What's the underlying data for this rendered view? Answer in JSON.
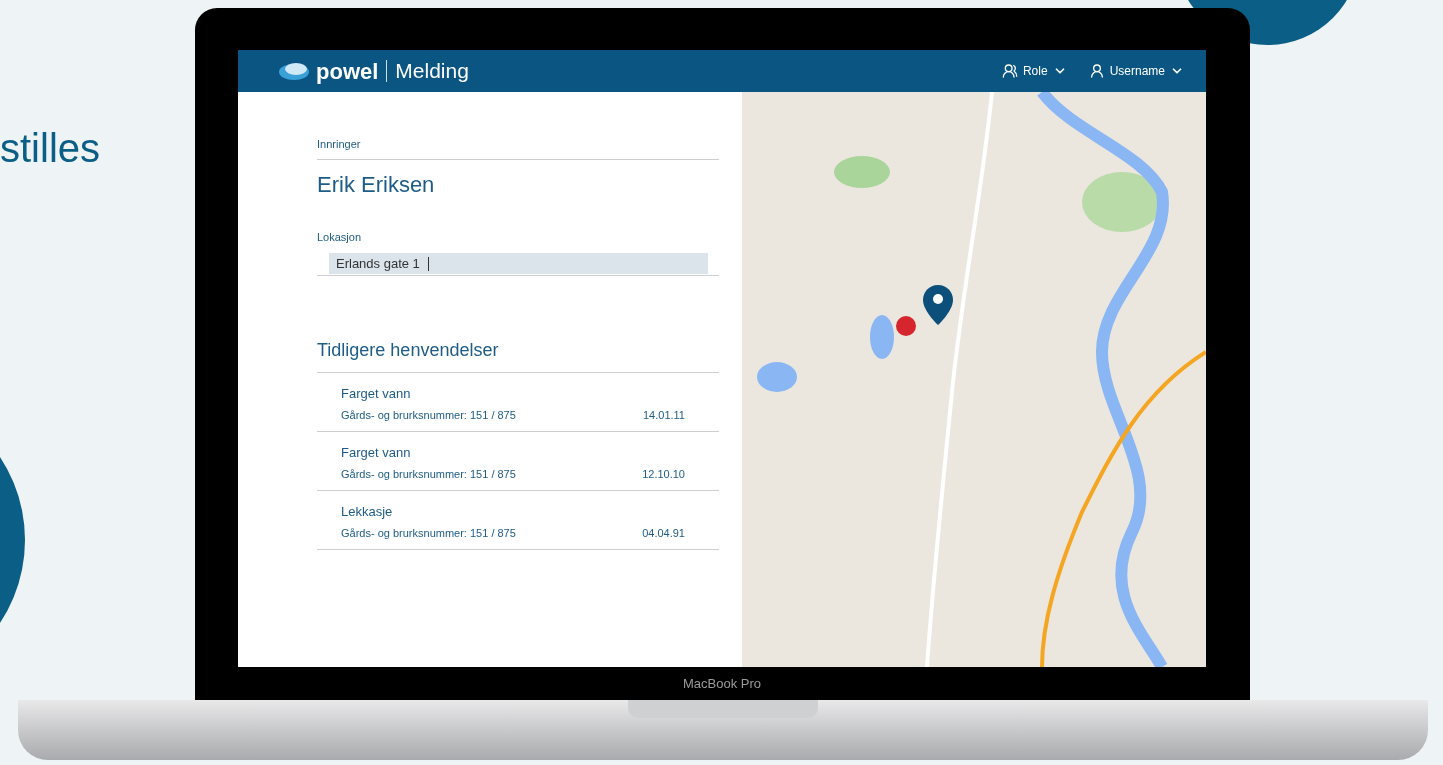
{
  "background_text": "stilles",
  "header": {
    "logo": "powel",
    "app_name": "Melding",
    "menus": [
      {
        "label": "Role",
        "kind": "role"
      },
      {
        "label": "Username",
        "kind": "user"
      }
    ]
  },
  "caller": {
    "label": "Innringer",
    "name": "Erik Eriksen"
  },
  "location": {
    "label": "Lokasjon",
    "value": "Erlands gate 1"
  },
  "history": {
    "title": "Tidligere henvendelser",
    "items": [
      {
        "title": "Farget vann",
        "detail": "Gårds- og brurksnummer: 151 / 875",
        "date": "14.01.11"
      },
      {
        "title": "Farget vann",
        "detail": "Gårds- og brurksnummer: 151 / 875",
        "date": "12.10.10"
      },
      {
        "title": "Lekkasje",
        "detail": "Gårds- og brurksnummer: 151 / 875",
        "date": "04.04.91"
      }
    ]
  },
  "laptop_label": "MacBook Pro"
}
